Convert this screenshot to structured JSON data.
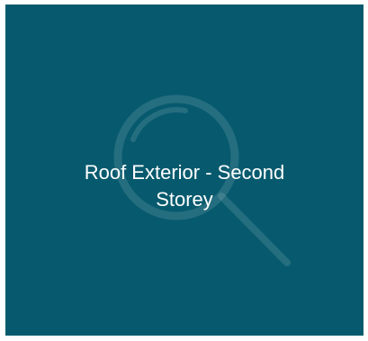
{
  "tile": {
    "title_line1": "Roof Exterior - Second",
    "title_line2": "Storey",
    "background_color": "#075A6E",
    "text_color": "#FFFFFF",
    "icon": "magnifying-glass-icon"
  }
}
